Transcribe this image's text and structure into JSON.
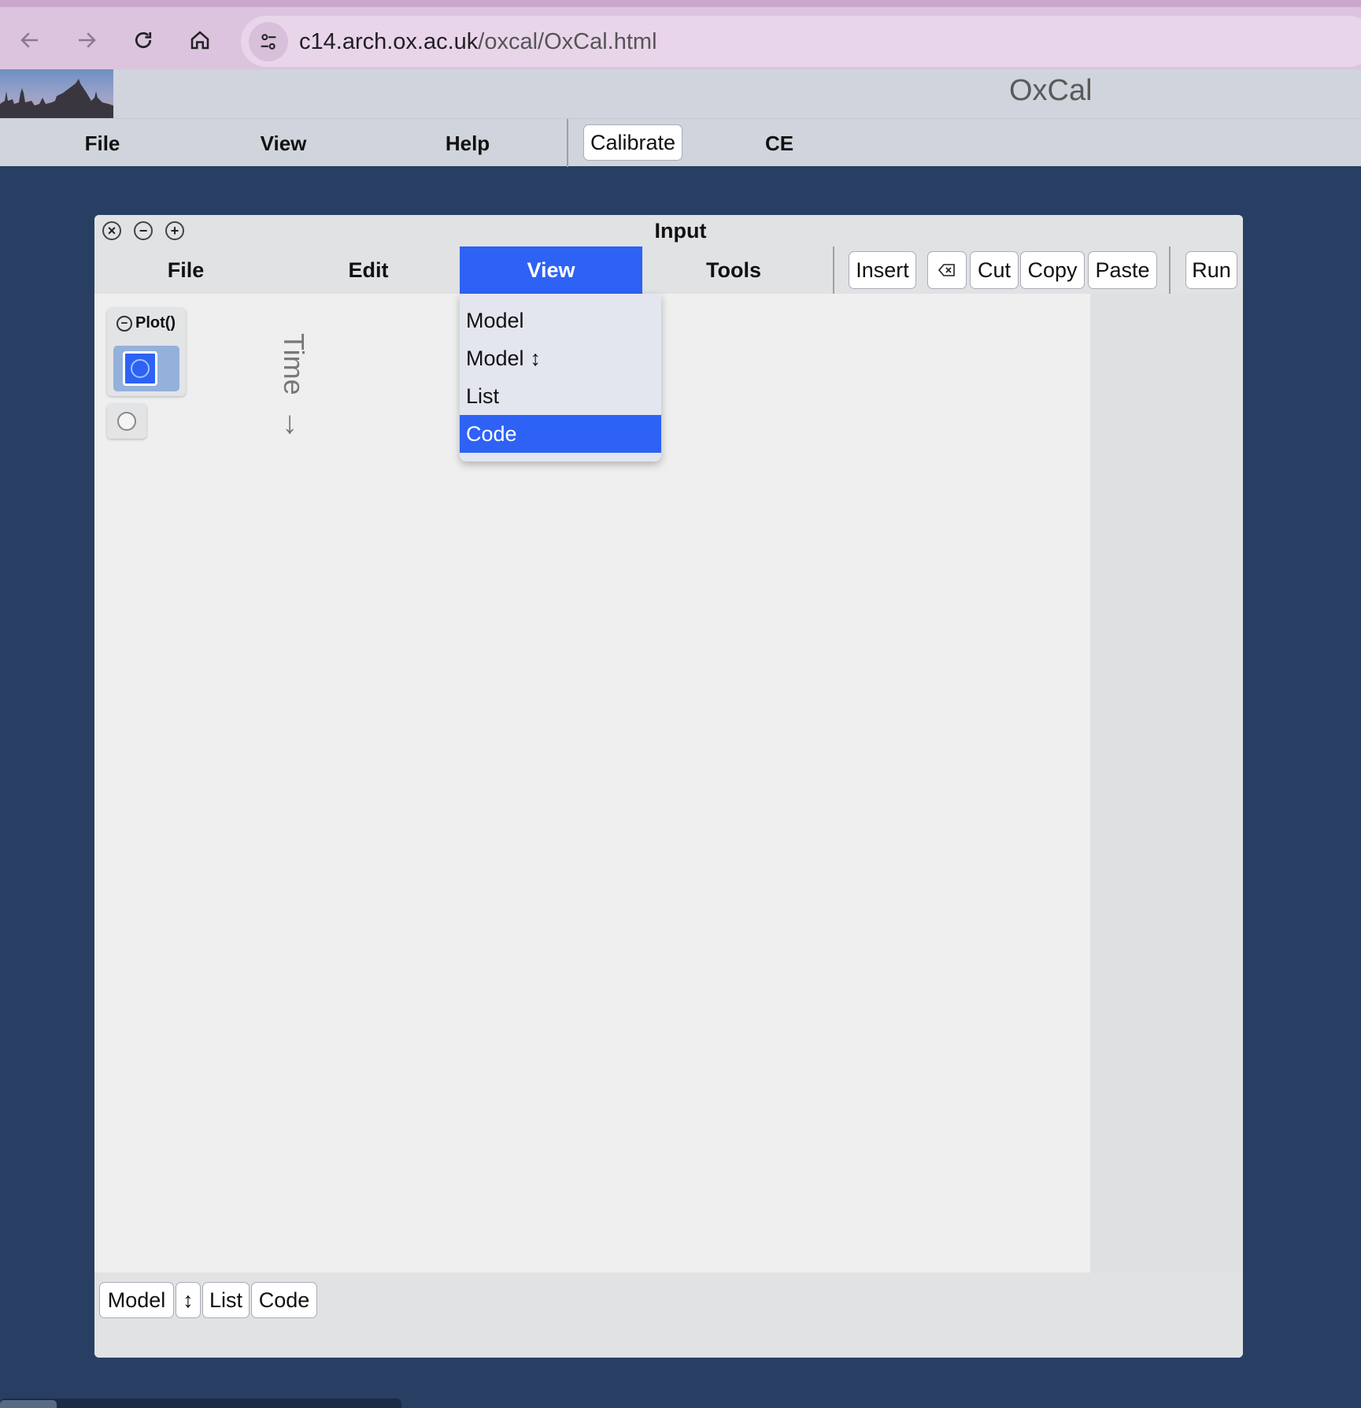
{
  "browser": {
    "url_host": "c14.arch.ox.ac.uk",
    "url_path": "/oxcal/OxCal.html",
    "back_icon": "arrow-left-icon",
    "forward_icon": "arrow-right-icon",
    "reload_icon": "reload-icon",
    "home_icon": "home-icon",
    "site_info_icon": "tune-icon"
  },
  "app": {
    "title": "OxCal",
    "menu": {
      "file": "File",
      "view": "View",
      "help": "Help",
      "calibrate": "Calibrate",
      "ce": "CE"
    }
  },
  "window": {
    "title": "Input",
    "menu": {
      "file": "File",
      "edit": "Edit",
      "view": "View",
      "tools": "Tools"
    },
    "toolbar": {
      "insert": "Insert",
      "delete_icon": "backspace-icon",
      "cut": "Cut",
      "copy": "Copy",
      "paste": "Paste",
      "run": "Run"
    },
    "tree": {
      "plot_label": "Plot()"
    },
    "axis_label": "Time",
    "axis_arrow": "↓",
    "dropdown": {
      "items": [
        {
          "label": "Model",
          "suffix": ""
        },
        {
          "label": "Model",
          "suffix": "↕"
        },
        {
          "label": "List",
          "suffix": ""
        },
        {
          "label": "Code",
          "suffix": ""
        }
      ],
      "selected_index": 3
    },
    "bottom_buttons": {
      "model": "Model",
      "vertical": "↕",
      "list": "List",
      "code": "Code"
    }
  },
  "colors": {
    "accent": "#2d62f4",
    "desktop": "#283f63"
  }
}
